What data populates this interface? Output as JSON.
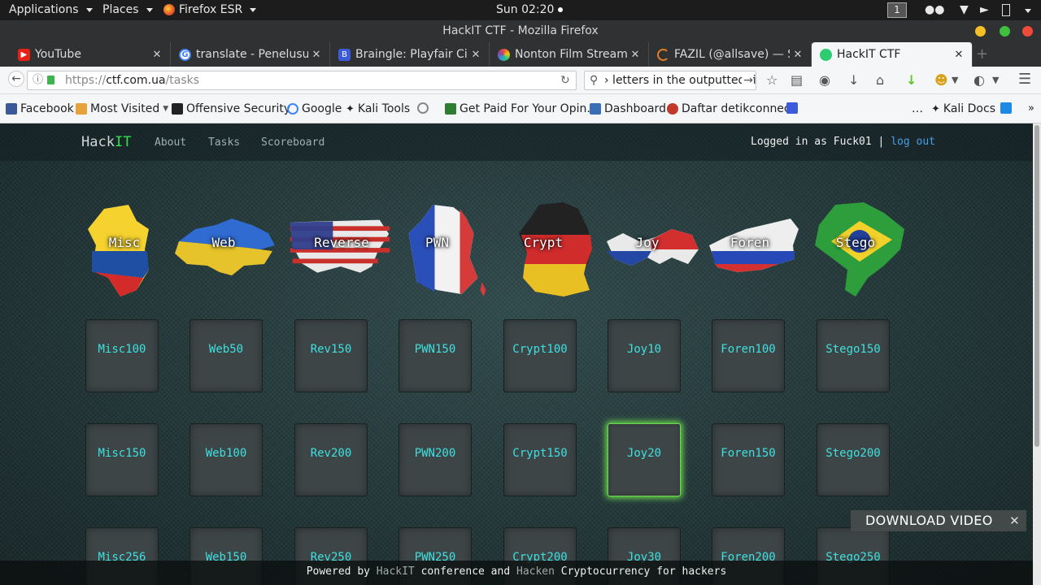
{
  "topbar": {
    "applications": "Applications",
    "places": "Places",
    "firefox": "Firefox ESR",
    "clock": "Sun 02:20",
    "workspace": "1"
  },
  "window": {
    "title": "HackIT CTF - Mozilla Firefox"
  },
  "tabs": [
    {
      "label": "YouTube",
      "color": "#e62117"
    },
    {
      "label": "translate - Penelusura...",
      "color": "#4285f4"
    },
    {
      "label": "Braingle: Playfair Cipher",
      "color": "#3b5bdb"
    },
    {
      "label": "Nonton Film Streamin...",
      "color": "#8e44ad"
    },
    {
      "label": "FAZIL (@allsave) — S...",
      "color": "#e67e22"
    },
    {
      "label": "HackIT CTF",
      "color": "#2ecc71"
    }
  ],
  "nav": {
    "url_scheme": "https://",
    "url_host": "ctf.com.ua",
    "url_path": "/tasks",
    "search_value": "› letters in the outputted file."
  },
  "bookmarks": [
    "Facebook",
    "Most Visited",
    "Offensive Security",
    "Google",
    "Kali Tools",
    "Get Paid For Your Opin...",
    "Dashboard",
    "Daftar detikconnect",
    "…",
    "Kali Docs"
  ],
  "site": {
    "brand_a": "Hack",
    "brand_b": "IT",
    "links": [
      "About",
      "Tasks",
      "Scoreboard"
    ],
    "logged_in": "Logged in as Fuck01 | ",
    "logout": "log out"
  },
  "categories": [
    "Misc",
    "Web",
    "Reverse",
    "PWN",
    "Crypt",
    "Joy",
    "Foren",
    "Stego"
  ],
  "tasks": [
    [
      "Misc100",
      "Web50",
      "Rev150",
      "PWN150",
      "Crypt100",
      "Joy10",
      "Foren100",
      "Stego150"
    ],
    [
      "Misc150",
      "Web100",
      "Rev200",
      "PWN200",
      "Crypt150",
      "Joy20",
      "Foren150",
      "Stego200"
    ],
    [
      "Misc256",
      "Web150",
      "Rev250",
      "PWN250",
      "Crypt200",
      "Joy30",
      "Foren200",
      "Stego250"
    ]
  ],
  "footer": {
    "a": "Powered by ",
    "b": "HackIT",
    "c": " conference and ",
    "d": "Hacken",
    "e": " Cryptocurrency for hackers"
  },
  "download": "DOWNLOAD VIDEO"
}
